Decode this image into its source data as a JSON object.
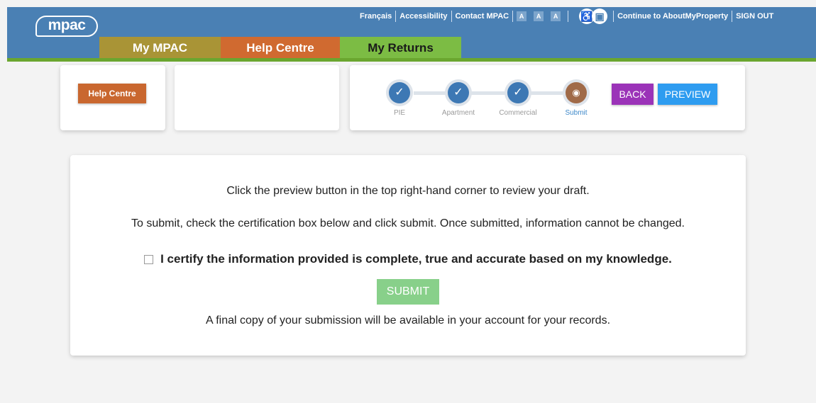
{
  "header": {
    "logo_text": "mpac",
    "topnav": {
      "francais": "Français",
      "accessibility": "Accessibility",
      "contact": "Contact MPAC",
      "font_buttons": [
        "A",
        "A",
        "A"
      ],
      "continue": "Continue to AboutMyProperty",
      "signout": "SIGN OUT"
    },
    "tabs": {
      "mympac": "My MPAC",
      "help": "Help Centre",
      "returns": "My Returns"
    },
    "colors": {
      "header_bg": "#4a80b4",
      "accent_green": "#6aa62f"
    }
  },
  "help_card": {
    "button_label": "Help Centre"
  },
  "stepper": {
    "steps": [
      {
        "label": "PIE",
        "icon": "check-icon",
        "glyph": "✓"
      },
      {
        "label": "Apartment",
        "icon": "check-icon",
        "glyph": "✓"
      },
      {
        "label": "Commercial",
        "icon": "check-icon",
        "glyph": "✓"
      },
      {
        "label": "Submit",
        "icon": "broadcast-icon",
        "glyph": "◉"
      }
    ],
    "back_label": "BACK",
    "preview_label": "PREVIEW"
  },
  "main": {
    "line1": "Click the preview button in the top right-hand corner to review your draft.",
    "line2": "To submit, check the certification box below and click submit. Once submitted, information cannot be changed.",
    "certify": "I certify the information provided is complete, true and accurate based on my knowledge.",
    "submit_label": "SUBMIT",
    "final_note": "A final copy of your submission will be available in your account for your records."
  }
}
